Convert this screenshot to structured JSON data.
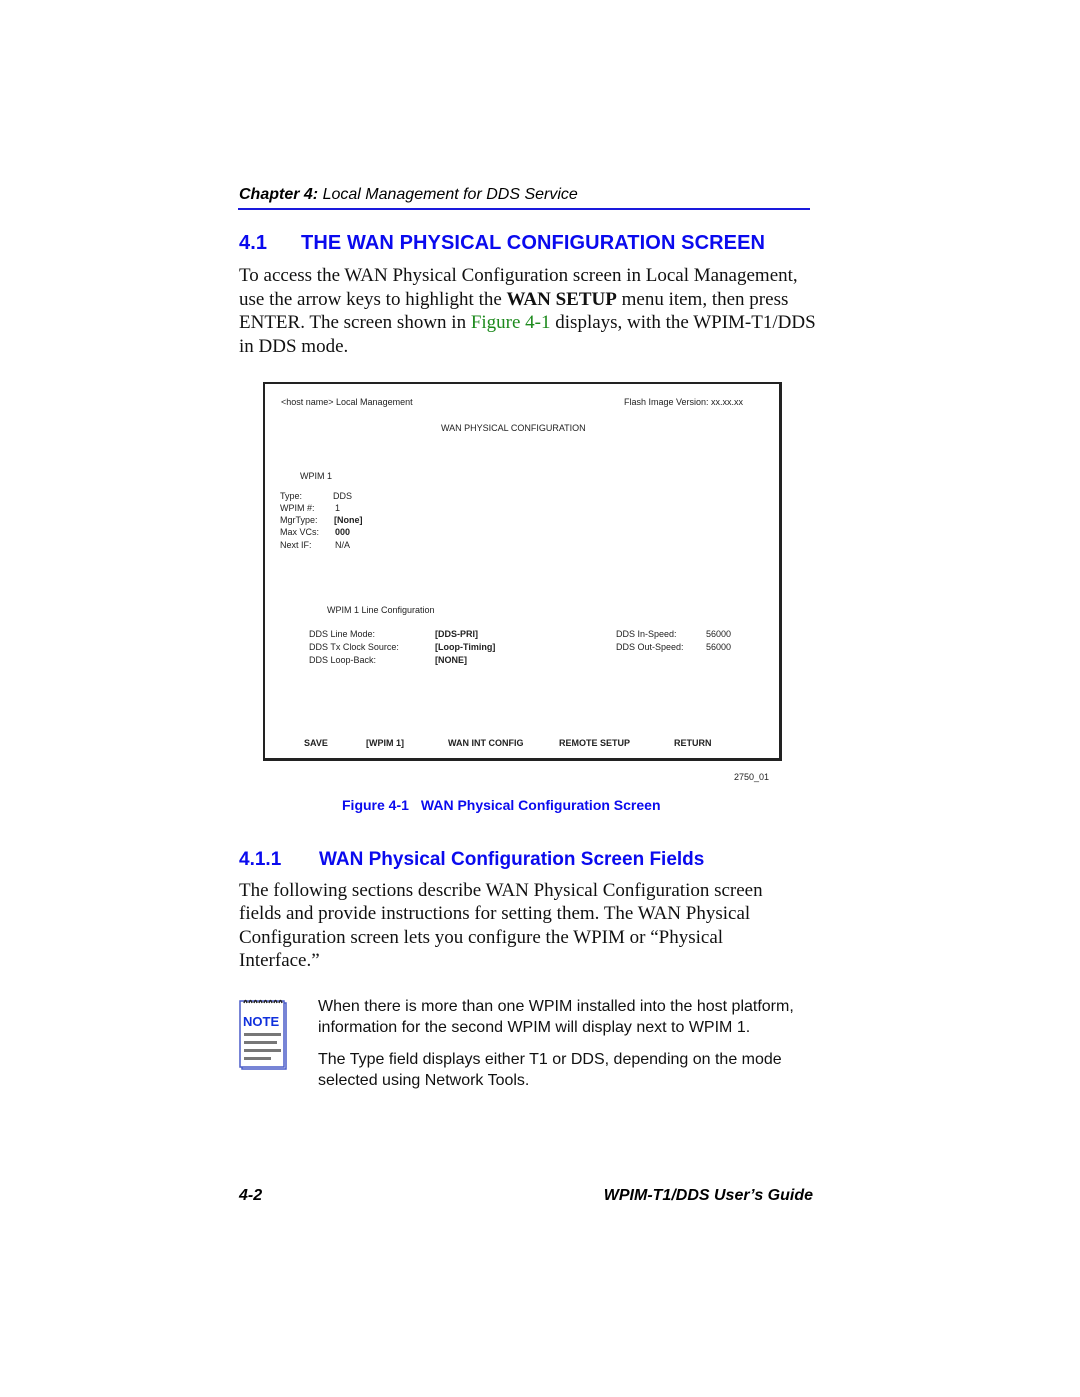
{
  "header": {
    "chapter_label": "Chapter 4:",
    "chapter_title": "Local Management for DDS Service"
  },
  "section": {
    "number": "4.1",
    "title": "THE WAN PHYSICAL CONFIGURATION SCREEN",
    "intro_part1": "To access the WAN Physical Configuration screen in Local Management, use the arrow keys to highlight the ",
    "intro_bold": "WAN SETUP",
    "intro_part2": " menu item, then press ENTER. The screen shown in ",
    "intro_xref": "Figure 4-1",
    "intro_part3": " displays, with the WPIM-T1/DDS in DDS mode."
  },
  "screen": {
    "host_label": "<host name> Local Management",
    "flash_version": "Flash Image Version: xx.xx.xx",
    "screen_title": "WAN PHYSICAL CONFIGURATION",
    "wpim_heading": "WPIM 1",
    "fields": [
      {
        "label": "Type:",
        "value": "DDS",
        "bold": false
      },
      {
        "label": "WPIM #:",
        "value": "1",
        "bold": false
      },
      {
        "label": "MgrType:",
        "value": "[None]",
        "bold": true
      },
      {
        "label": "Max VCs:",
        "value": "000",
        "bold": true
      },
      {
        "label": "Next IF:",
        "value": "N/A",
        "bold": false
      }
    ],
    "line_config_heading": "WPIM 1 Line Configuration",
    "line_fields": [
      {
        "label": "DDS Line Mode:",
        "value": "[DDS-PRI]"
      },
      {
        "label": "DDS Tx Clock Source:",
        "value": "[Loop-Timing]"
      },
      {
        "label": "DDS Loop-Back:",
        "value": "[NONE]"
      }
    ],
    "speed_fields": [
      {
        "label": "DDS In-Speed:",
        "value": "56000"
      },
      {
        "label": "DDS Out-Speed:",
        "value": "56000"
      }
    ],
    "commands": [
      {
        "label": "SAVE"
      },
      {
        "label": "[WPIM 1]"
      },
      {
        "label": "WAN INT CONFIG"
      },
      {
        "label": "REMOTE SETUP"
      },
      {
        "label": "RETURN"
      }
    ]
  },
  "figure": {
    "id": "2750_01",
    "caption_number": "Figure 4-1",
    "caption_title": "WAN Physical Configuration Screen"
  },
  "subsection": {
    "number": "4.1.1",
    "title": "WAN Physical Configuration Screen Fields",
    "body": "The following sections describe WAN Physical Configuration screen fields and provide instructions for setting them. The WAN Physical Configuration screen lets you configure the WPIM or “Physical Interface.”"
  },
  "note": {
    "icon_label": "NOTE",
    "paragraphs": [
      "When there is more than one WPIM installed into the host platform, information for the second WPIM will display next to WPIM 1.",
      "The Type field displays either T1 or DDS, depending on the mode selected using Network Tools."
    ]
  },
  "footer": {
    "page_number": "4-2",
    "guide_title": "WPIM-T1/DDS User’s Guide"
  },
  "colors": {
    "heading_blue": "#0a0aee",
    "xref_green": "#1d8a1d",
    "rule_blue": "#1a1adc"
  }
}
